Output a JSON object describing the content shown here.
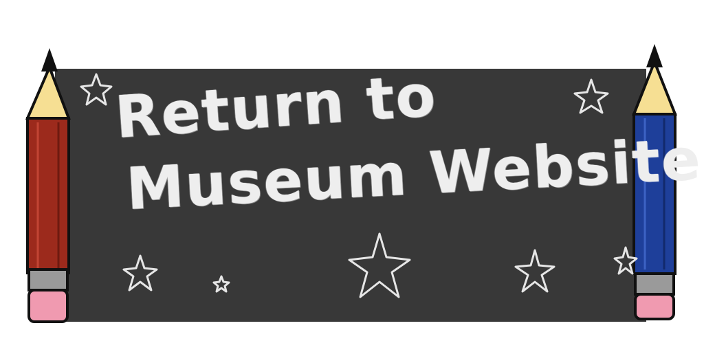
{
  "banner": {
    "line1": "Return to",
    "line2": "Museum Website"
  },
  "colors": {
    "board": "#383838",
    "chalk": "#eeeeee",
    "pencil_left_body": "#9c2a1c",
    "pencil_right_body": "#1e3f9a",
    "pencil_tip": "#f6df93",
    "eraser": "#f09ab0",
    "ferrule": "#9a9a9a"
  },
  "icons": [
    "red-pencil-icon",
    "blue-pencil-icon",
    "star-icon"
  ]
}
